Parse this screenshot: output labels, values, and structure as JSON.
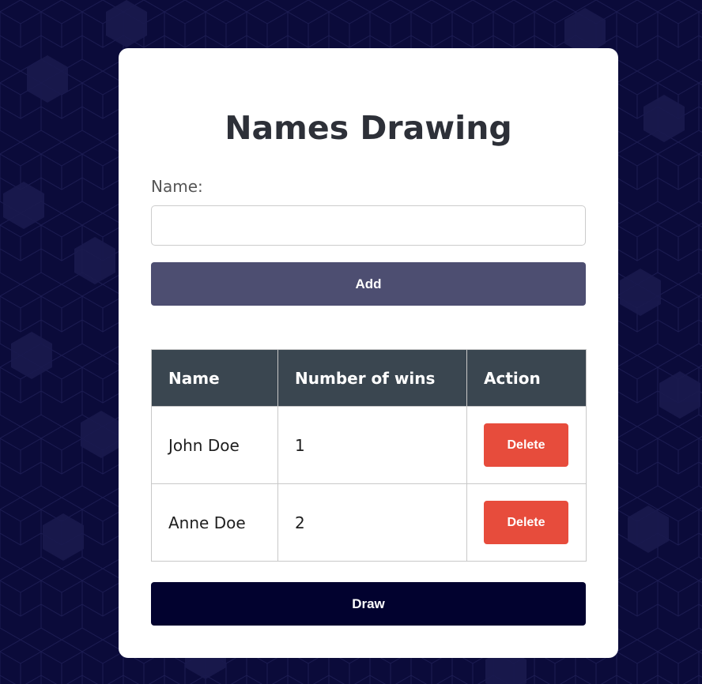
{
  "app": {
    "title": "Names Drawing"
  },
  "form": {
    "name_label": "Name:",
    "name_value": "",
    "name_placeholder": "",
    "add_label": "Add"
  },
  "table": {
    "headers": [
      "Name",
      "Number of wins",
      "Action"
    ],
    "rows": [
      {
        "name": "John Doe",
        "wins": "1",
        "action_label": "Delete"
      },
      {
        "name": "Anne Doe",
        "wins": "2",
        "action_label": "Delete"
      }
    ]
  },
  "draw_label": "Draw",
  "colors": {
    "background": "#0b0b3a",
    "card": "#ffffff",
    "add_button": "#4d4e71",
    "draw_button": "#02022f",
    "delete_button": "#e74c3c",
    "table_header": "#3a4650"
  }
}
